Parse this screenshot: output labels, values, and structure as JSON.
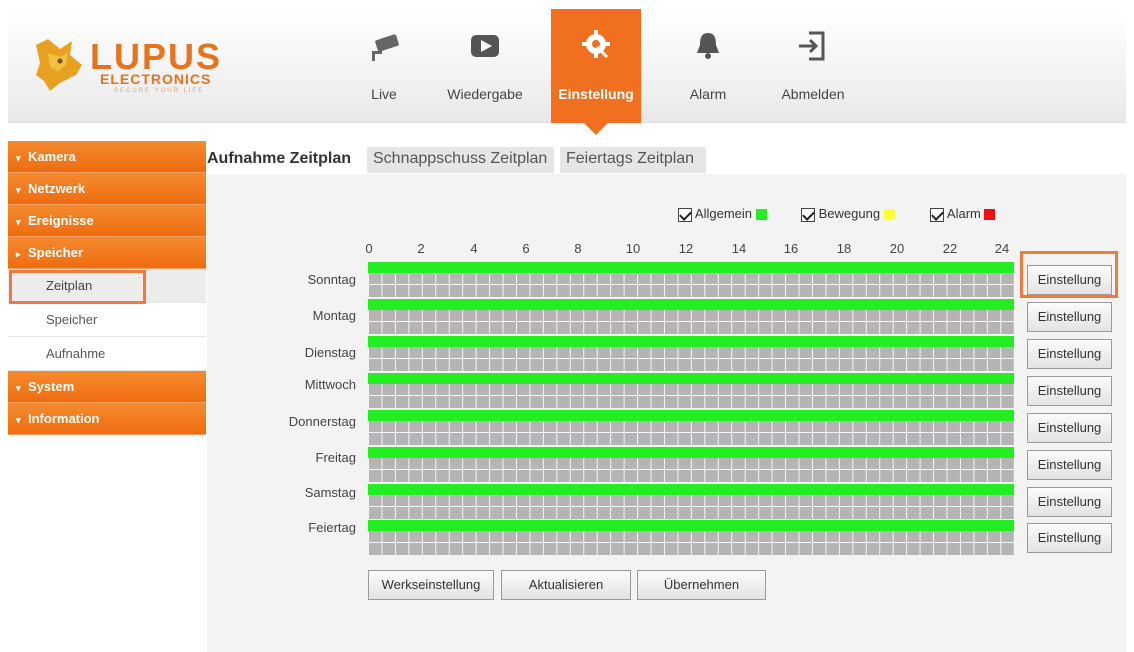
{
  "brand": {
    "name": "LUPUS",
    "sub": "ELECTRONICS",
    "tagline": "SECURE YOUR LIFE",
    "color": "#e8731a"
  },
  "nav": [
    {
      "label": "Live",
      "icon": "camera-icon"
    },
    {
      "label": "Wiedergabe",
      "icon": "play-icon"
    },
    {
      "label": "Einstellung",
      "icon": "gear-icon",
      "active": true
    },
    {
      "label": "Alarm",
      "icon": "bell-icon"
    },
    {
      "label": "Abmelden",
      "icon": "logout-icon"
    }
  ],
  "sidebar": {
    "items": [
      {
        "label": "Kamera",
        "type": "category",
        "expanded": false
      },
      {
        "label": "Netzwerk",
        "type": "category",
        "expanded": false
      },
      {
        "label": "Ereignisse",
        "type": "category",
        "expanded": false
      },
      {
        "label": "Speicher",
        "type": "category",
        "expanded": true
      },
      {
        "label": "Zeitplan",
        "type": "sub",
        "active": true
      },
      {
        "label": "Speicher",
        "type": "sub"
      },
      {
        "label": "Aufnahme",
        "type": "sub"
      },
      {
        "label": "System",
        "type": "category",
        "expanded": false
      },
      {
        "label": "Information",
        "type": "category",
        "expanded": false
      }
    ]
  },
  "tabs": [
    "Aufnahme Zeitplan",
    "Schnappschuss Zeitplan",
    "Feiertags Zeitplan"
  ],
  "legend": [
    {
      "label": "Allgemein",
      "checked": true,
      "color": "#22ee22"
    },
    {
      "label": "Bewegung",
      "checked": true,
      "color": "#ffff33"
    },
    {
      "label": "Alarm",
      "checked": true,
      "color": "#ee1111"
    }
  ],
  "hours": [
    "0",
    "2",
    "4",
    "6",
    "8",
    "10",
    "12",
    "14",
    "16",
    "18",
    "20",
    "22",
    "24"
  ],
  "days": [
    "Sonntag",
    "Montag",
    "Dienstag",
    "Mittwoch",
    "Donnerstag",
    "Freitag",
    "Samstag",
    "Feiertag"
  ],
  "row_button_label": "Einstellung",
  "buttons": {
    "reset": "Werkseinstellung",
    "refresh": "Aktualisieren",
    "apply": "Übernehmen"
  },
  "colors": {
    "accent": "#f07020",
    "highlight_box": "#f07a3a",
    "schedule_active": "#22ee22",
    "cell_empty": "#b4b4b4"
  }
}
